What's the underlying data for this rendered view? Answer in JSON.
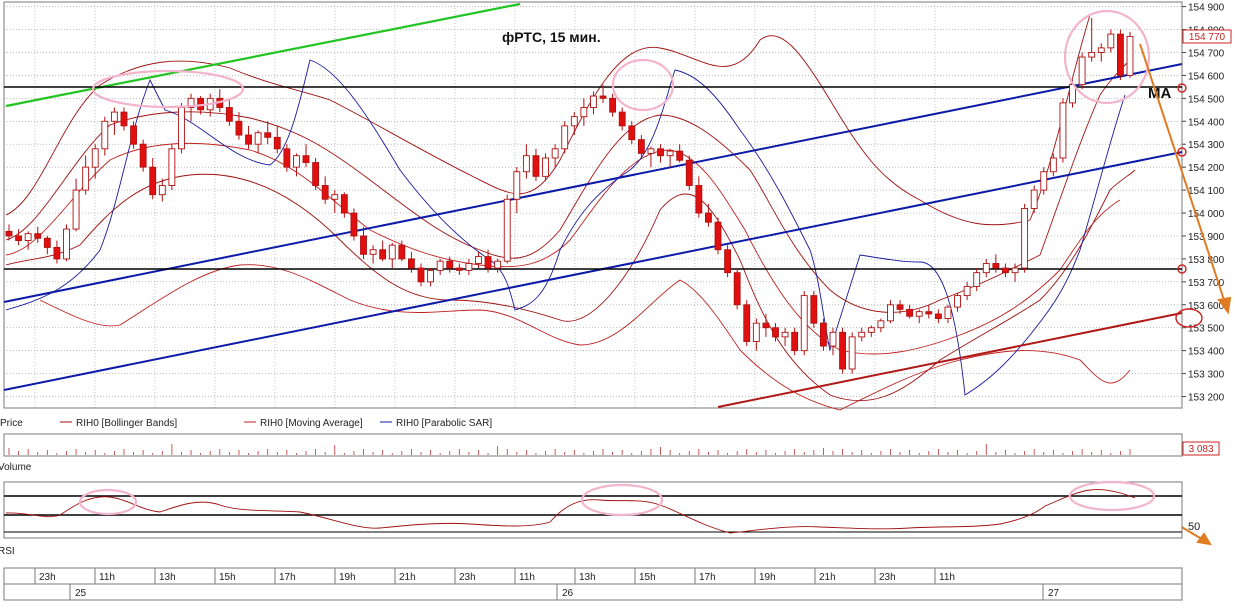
{
  "chart_data": {
    "type": "candlestick",
    "title": "фРТС,  15 мин.",
    "price_axis": {
      "ylim": [
        153150,
        154920
      ],
      "ticks": [
        "154 900",
        "154 800",
        "154 700",
        "154 600",
        "154 500",
        "154 400",
        "154 300",
        "154 200",
        "154 100",
        "154 000",
        "153 900",
        "153 800",
        "153 700",
        "153 600",
        "153 500",
        "153 400",
        "153 300",
        "153 200"
      ],
      "tick_values": [
        154900,
        154800,
        154700,
        154600,
        154500,
        154400,
        154300,
        154200,
        154100,
        154000,
        153900,
        153800,
        153700,
        153600,
        153500,
        153400,
        153300,
        153200
      ],
      "last_price_label": "154 770",
      "last_price": 154770
    },
    "legend": [
      {
        "label": "Price",
        "color": "#cc0000"
      },
      {
        "label": "RIH0 [Bollinger Bands]",
        "color": "#a01010"
      },
      {
        "label": "RIH0 [Moving Average]",
        "color": "#c02020"
      },
      {
        "label": "RIH0 [Parabolic SAR]",
        "color": "#1a1aa0"
      }
    ],
    "annotations": {
      "ma_label": "MA",
      "rsi_level_label": "50"
    },
    "volume_panel": {
      "label": "Volume",
      "last_value_label": "3 083"
    },
    "rsi_panel": {
      "label": "RSI"
    },
    "time_axis": {
      "ticks": [
        "23h",
        "11h",
        "13h",
        "15h",
        "17h",
        "19h",
        "21h",
        "23h",
        "11h",
        "13h",
        "15h",
        "17h",
        "19h",
        "21h",
        "23h",
        "11h"
      ],
      "dates": [
        "25",
        "26",
        "27"
      ]
    },
    "candles": [
      [
        153920,
        153950,
        153880,
        153900
      ],
      [
        153900,
        153930,
        153860,
        153880
      ],
      [
        153880,
        153920,
        153840,
        153910
      ],
      [
        153910,
        153940,
        153870,
        153890
      ],
      [
        153890,
        153900,
        153820,
        153850
      ],
      [
        153850,
        153880,
        153780,
        153800
      ],
      [
        153800,
        153950,
        153790,
        153930
      ],
      [
        153930,
        154150,
        153920,
        154100
      ],
      [
        154100,
        154250,
        154080,
        154200
      ],
      [
        154200,
        154300,
        154150,
        154280
      ],
      [
        154280,
        154420,
        154250,
        154400
      ],
      [
        154400,
        154460,
        154340,
        154440
      ],
      [
        154440,
        154460,
        154360,
        154380
      ],
      [
        154380,
        154400,
        154280,
        154300
      ],
      [
        154300,
        154320,
        154180,
        154200
      ],
      [
        154200,
        154240,
        154060,
        154080
      ],
      [
        154080,
        154150,
        154050,
        154120
      ],
      [
        154120,
        154300,
        154100,
        154280
      ],
      [
        154280,
        154480,
        154260,
        154460
      ],
      [
        154460,
        154520,
        154400,
        154500
      ],
      [
        154500,
        154510,
        154430,
        154450
      ],
      [
        154450,
        154520,
        154420,
        154500
      ],
      [
        154500,
        154540,
        154440,
        154460
      ],
      [
        154460,
        154500,
        154380,
        154400
      ],
      [
        154400,
        154440,
        154320,
        154340
      ],
      [
        154340,
        154380,
        154280,
        154300
      ],
      [
        154300,
        154360,
        154260,
        154350
      ],
      [
        154350,
        154400,
        154300,
        154330
      ],
      [
        154330,
        154380,
        154260,
        154280
      ],
      [
        154280,
        154300,
        154180,
        154200
      ],
      [
        154200,
        154260,
        154160,
        154250
      ],
      [
        154250,
        154300,
        154200,
        154220
      ],
      [
        154220,
        154240,
        154100,
        154120
      ],
      [
        154120,
        154160,
        154040,
        154060
      ],
      [
        154060,
        154100,
        154000,
        154080
      ],
      [
        154080,
        154090,
        153980,
        154000
      ],
      [
        154000,
        154020,
        153880,
        153900
      ],
      [
        153900,
        153940,
        153800,
        153820
      ],
      [
        153820,
        153860,
        153780,
        153840
      ],
      [
        153840,
        153880,
        153790,
        153800
      ],
      [
        153800,
        153870,
        153760,
        153860
      ],
      [
        153860,
        153880,
        153790,
        153800
      ],
      [
        153800,
        153830,
        153740,
        153760
      ],
      [
        153760,
        153780,
        153680,
        153700
      ],
      [
        153700,
        153760,
        153680,
        153750
      ],
      [
        153750,
        153800,
        153730,
        153790
      ],
      [
        153790,
        153810,
        153740,
        153760
      ],
      [
        153760,
        153780,
        153730,
        153750
      ],
      [
        153750,
        153800,
        153730,
        153780
      ],
      [
        153780,
        153830,
        153760,
        153810
      ],
      [
        153810,
        153840,
        153740,
        153760
      ],
      [
        153760,
        153800,
        153740,
        153790
      ],
      [
        153790,
        154080,
        153780,
        154060
      ],
      [
        154060,
        154200,
        154000,
        154180
      ],
      [
        154180,
        154300,
        154150,
        154250
      ],
      [
        154250,
        154280,
        154140,
        154160
      ],
      [
        154160,
        154260,
        154140,
        154240
      ],
      [
        154240,
        154300,
        154200,
        154280
      ],
      [
        154280,
        154400,
        154260,
        154380
      ],
      [
        154380,
        154440,
        154340,
        154420
      ],
      [
        154420,
        154500,
        154380,
        154460
      ],
      [
        154460,
        154530,
        154430,
        154510
      ],
      [
        154510,
        154560,
        154480,
        154500
      ],
      [
        154500,
        154520,
        154420,
        154440
      ],
      [
        154440,
        154460,
        154360,
        154380
      ],
      [
        154380,
        154400,
        154300,
        154320
      ],
      [
        154320,
        154340,
        154240,
        154260
      ],
      [
        154260,
        154290,
        154200,
        154280
      ],
      [
        154280,
        154300,
        154220,
        154250
      ],
      [
        154250,
        154280,
        154200,
        154270
      ],
      [
        154270,
        154300,
        154220,
        154230
      ],
      [
        154230,
        154250,
        154100,
        154120
      ],
      [
        154120,
        154160,
        153980,
        154000
      ],
      [
        154000,
        154040,
        153940,
        153960
      ],
      [
        153960,
        153980,
        153820,
        153840
      ],
      [
        153840,
        153860,
        153720,
        153740
      ],
      [
        153740,
        153760,
        153580,
        153600
      ],
      [
        153600,
        153620,
        153420,
        153440
      ],
      [
        153440,
        153540,
        153400,
        153520
      ],
      [
        153520,
        153560,
        153460,
        153500
      ],
      [
        153500,
        153520,
        153440,
        153460
      ],
      [
        153460,
        153500,
        153420,
        153480
      ],
      [
        153480,
        153500,
        153380,
        153400
      ],
      [
        153400,
        153660,
        153380,
        153640
      ],
      [
        153640,
        153660,
        153500,
        153520
      ],
      [
        153520,
        153540,
        153400,
        153420
      ],
      [
        153420,
        153500,
        153380,
        153480
      ],
      [
        153480,
        153500,
        153300,
        153320
      ],
      [
        153320,
        153480,
        153300,
        153460
      ],
      [
        153460,
        153500,
        153440,
        153480
      ],
      [
        153480,
        153510,
        153460,
        153500
      ],
      [
        153500,
        153540,
        153480,
        153530
      ],
      [
        153530,
        153620,
        153520,
        153600
      ],
      [
        153600,
        153620,
        153560,
        153580
      ],
      [
        153580,
        153600,
        153540,
        153550
      ],
      [
        153550,
        153580,
        153520,
        153570
      ],
      [
        153570,
        153600,
        153540,
        153560
      ],
      [
        153560,
        153580,
        153520,
        153540
      ],
      [
        153540,
        153600,
        153520,
        153590
      ],
      [
        153590,
        153650,
        153570,
        153640
      ],
      [
        153640,
        153700,
        153620,
        153680
      ],
      [
        153680,
        153760,
        153660,
        153740
      ],
      [
        153740,
        153800,
        153720,
        153780
      ],
      [
        153780,
        153820,
        153740,
        153760
      ],
      [
        153760,
        153780,
        153720,
        153740
      ],
      [
        153740,
        153780,
        153700,
        153760
      ],
      [
        153760,
        154040,
        153740,
        154020
      ],
      [
        154020,
        154120,
        154000,
        154100
      ],
      [
        154100,
        154200,
        154080,
        154180
      ],
      [
        154180,
        154260,
        154160,
        154240
      ],
      [
        154240,
        154500,
        154220,
        154480
      ],
      [
        154480,
        154580,
        154460,
        154560
      ],
      [
        154560,
        154700,
        154540,
        154680
      ],
      [
        154680,
        154850,
        154660,
        154700
      ],
      [
        154700,
        154740,
        154660,
        154720
      ],
      [
        154720,
        154800,
        154700,
        154780
      ],
      [
        154780,
        154800,
        154580,
        154600
      ],
      [
        154600,
        154790,
        154590,
        154770
      ]
    ]
  }
}
